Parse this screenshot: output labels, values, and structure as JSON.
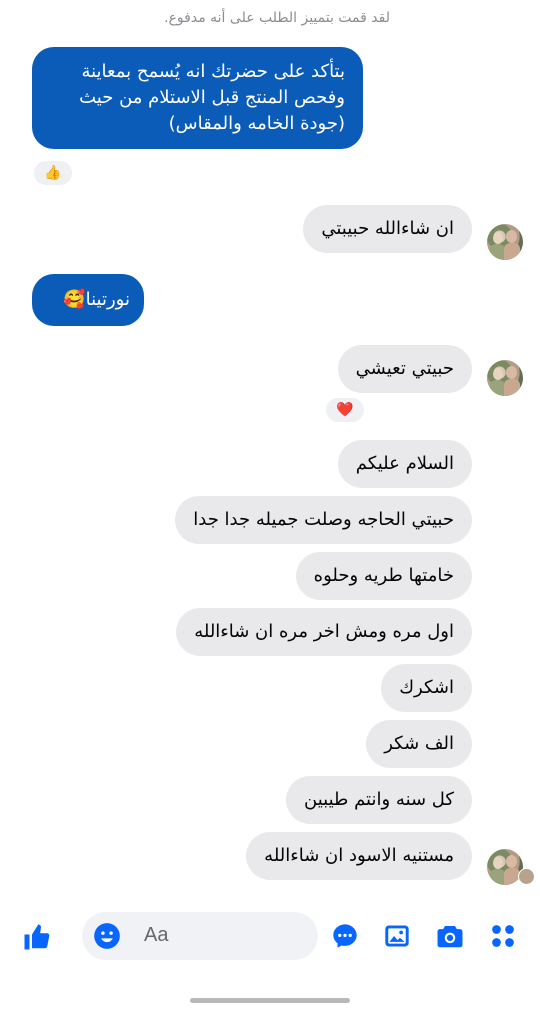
{
  "system_note": "لقد قمت بتمييز الطلب على أنه مدفوع.",
  "messages": [
    {
      "text": "بتأكد على حضرتك انه يُسمح بمعاينة وفحص المنتج قبل الاستلام من حيث (جودة الخامه والمقاس)",
      "reaction": "👍"
    },
    {
      "text": "ان شاءالله حبيبتي"
    },
    {
      "text": "نورتينا🥰"
    },
    {
      "text": "حبيتي تعيشي",
      "reaction": "❤️"
    },
    {
      "text": "السلام عليكم"
    },
    {
      "text": "حبيتي الحاجه وصلت جميله جدا جدا"
    },
    {
      "text": "خامتها طريه وحلوه"
    },
    {
      "text": "اول مره ومش اخر مره ان شاءالله"
    },
    {
      "text": "اشكرك"
    },
    {
      "text": "الف شكر"
    },
    {
      "text": "كل سنه وانتم طيبين"
    },
    {
      "text": "مستنيه الاسود ان شاءالله"
    }
  ],
  "composer": {
    "placeholder": "Aa",
    "icons": [
      "like-icon",
      "emoji-icon",
      "chat-bubble-icon",
      "gallery-icon",
      "camera-icon",
      "apps-grid-icon"
    ]
  },
  "colors": {
    "outgoing_bubble": "#0a5cb8",
    "incoming_bubble": "#e9e9eb",
    "accent": "#0866ff"
  }
}
